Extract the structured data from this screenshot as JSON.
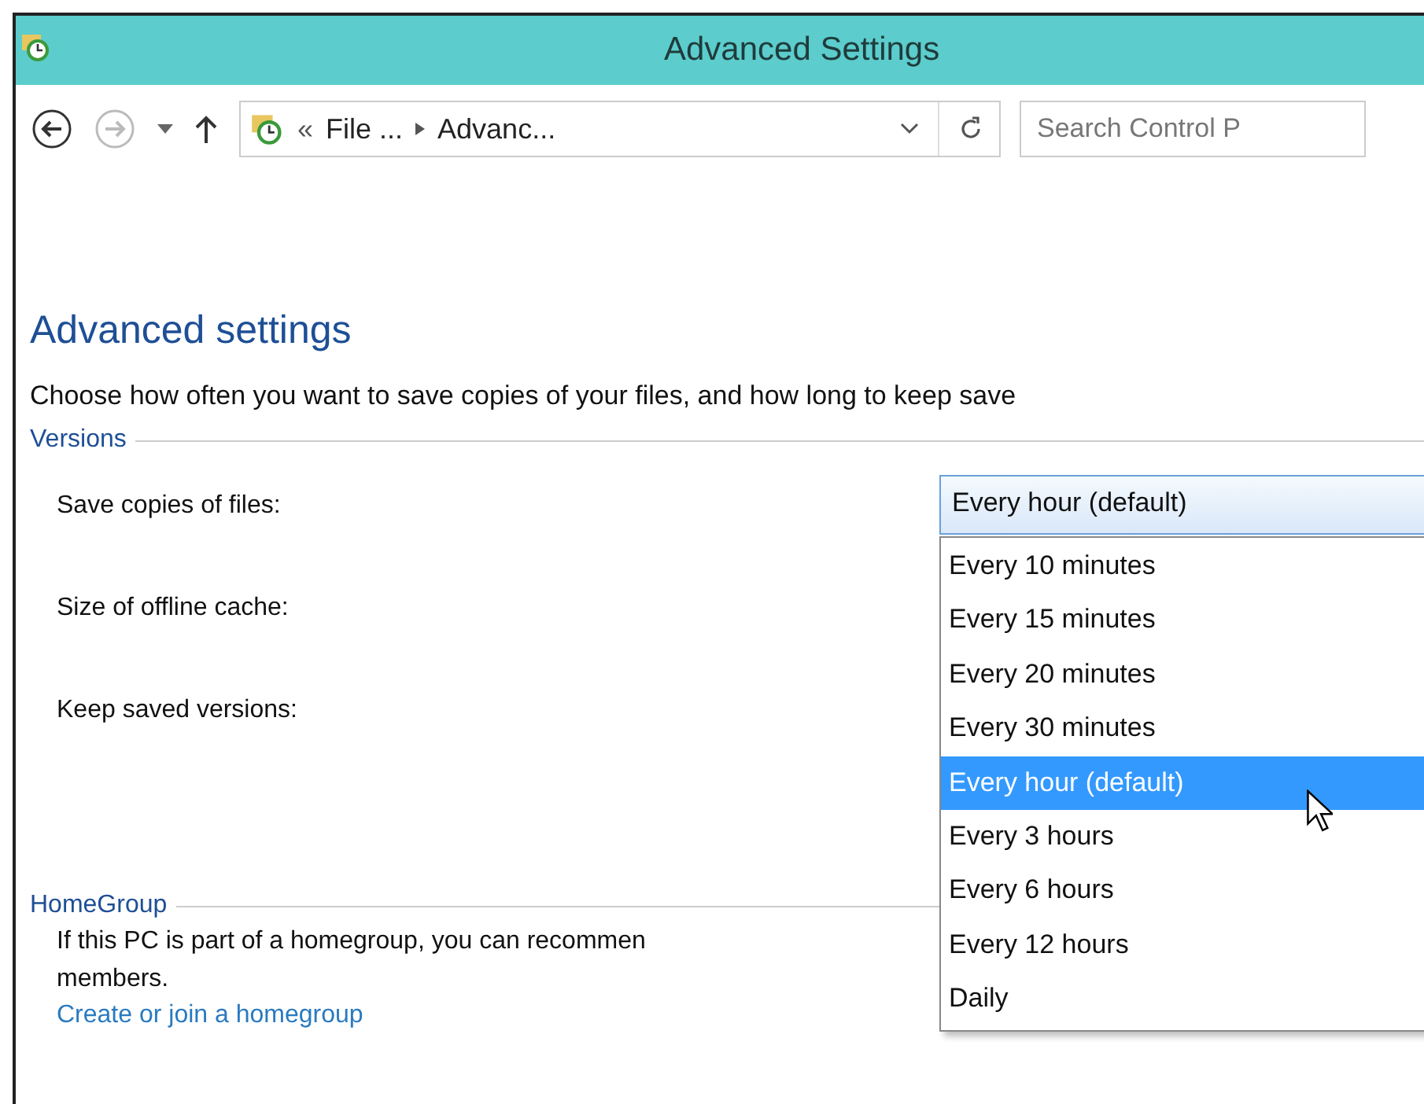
{
  "window": {
    "title": "Advanced Settings"
  },
  "nav": {
    "back_disabled": false,
    "forward_disabled": true
  },
  "address": {
    "overflow_mark": "«",
    "crumbs": [
      "File ...",
      "Advanc..."
    ]
  },
  "search": {
    "placeholder": "Search Control P"
  },
  "heading": "Advanced settings",
  "description": "Choose how often you want to save copies of your files, and how long to keep save",
  "versions": {
    "title": "Versions",
    "rows": [
      {
        "label": "Save copies of files:"
      },
      {
        "label": "Size of offline cache:"
      },
      {
        "label": "Keep saved versions:"
      }
    ]
  },
  "dropdown": {
    "value": "Every hour (default)",
    "expanded": true,
    "options": [
      {
        "label": "Every 10 minutes",
        "selected": false
      },
      {
        "label": "Every 15 minutes",
        "selected": false
      },
      {
        "label": "Every 20 minutes",
        "selected": false
      },
      {
        "label": "Every 30 minutes",
        "selected": false
      },
      {
        "label": "Every hour (default)",
        "selected": true
      },
      {
        "label": "Every 3 hours",
        "selected": false
      },
      {
        "label": "Every 6 hours",
        "selected": false
      },
      {
        "label": "Every 12 hours",
        "selected": false
      },
      {
        "label": "Daily",
        "selected": false
      }
    ]
  },
  "homegroup": {
    "title": "HomeGroup",
    "lines": [
      "If this PC is part of a homegroup, you can recommen",
      "members."
    ],
    "link": "Create or join a homegroup"
  }
}
